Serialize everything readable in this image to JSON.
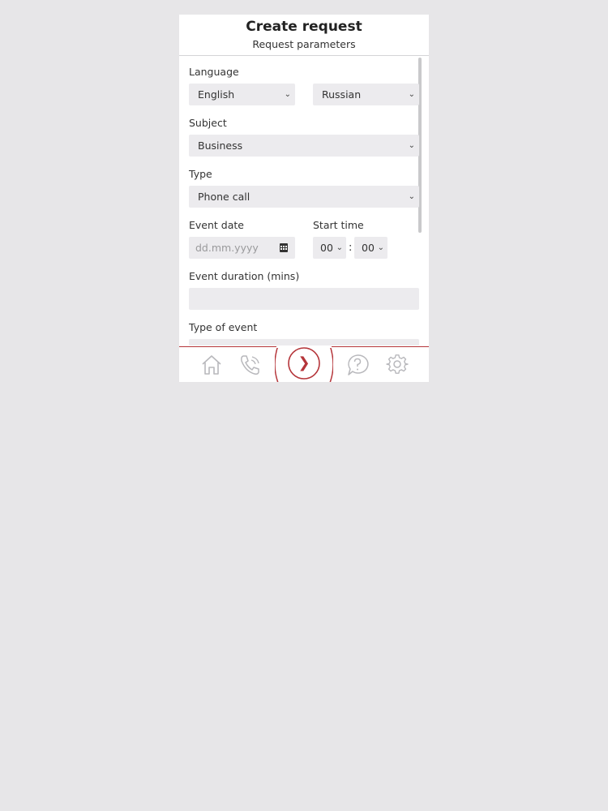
{
  "header": {
    "title": "Create request",
    "subtitle": "Request parameters"
  },
  "form": {
    "language_label": "Language",
    "language_from": "English",
    "language_to": "Russian",
    "subject_label": "Subject",
    "subject_value": "Business",
    "type_label": "Type",
    "type_value": "Phone call",
    "event_date_label": "Event date",
    "event_date_placeholder": "dd.mm.yyyy",
    "start_time_label": "Start time",
    "start_hour": "00",
    "start_minute": "00",
    "time_separator": ":",
    "duration_label": "Event duration (mins)",
    "duration_value": "",
    "type_of_event_label": "Type of event"
  },
  "navbar": {
    "items": [
      "home-icon",
      "phone-call-icon",
      "next-arrow-icon",
      "help-chat-icon",
      "settings-gear-icon"
    ],
    "next_glyph": "❯"
  },
  "colors": {
    "accent": "#b5353a",
    "background": "#e7e6e8",
    "field": "#ecebee",
    "icon_gray": "#b8b8bc"
  }
}
